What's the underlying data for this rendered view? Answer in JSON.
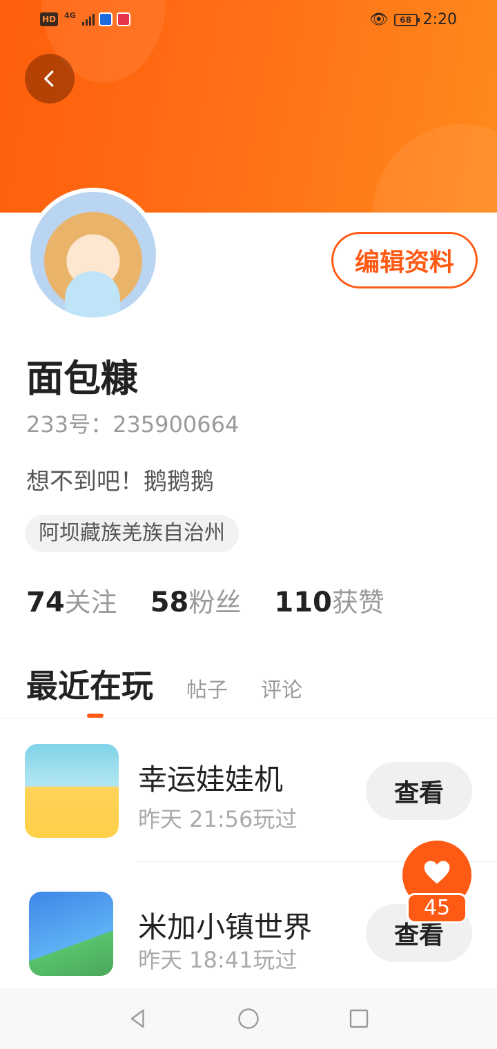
{
  "status_bar": {
    "left_tags": [
      "HD",
      "4G"
    ],
    "battery": "68",
    "time": "2:20"
  },
  "profile": {
    "name": "面包糠",
    "id_line": "233号：235900664",
    "bio": "想不到吧！鹅鹅鹅",
    "location": "阿坝藏族羌族自治州",
    "edit_label": "编辑资料"
  },
  "stats": [
    {
      "num": "74",
      "label": "关注"
    },
    {
      "num": "58",
      "label": "粉丝"
    },
    {
      "num": "110",
      "label": "获赞"
    }
  ],
  "tabs": {
    "active": "最近在玩",
    "items": [
      "帖子",
      "评论"
    ]
  },
  "games": [
    {
      "name": "幸运娃娃机",
      "time": "昨天 21:56玩过",
      "button": "查看"
    },
    {
      "name": "米加小镇世界",
      "time": "昨天 18:41玩过",
      "button": "查看"
    }
  ],
  "fab": {
    "count": "45"
  },
  "colors": {
    "accent": "#ff5a14",
    "header_start": "#ff5e0a",
    "header_end": "#ff8a1c"
  }
}
